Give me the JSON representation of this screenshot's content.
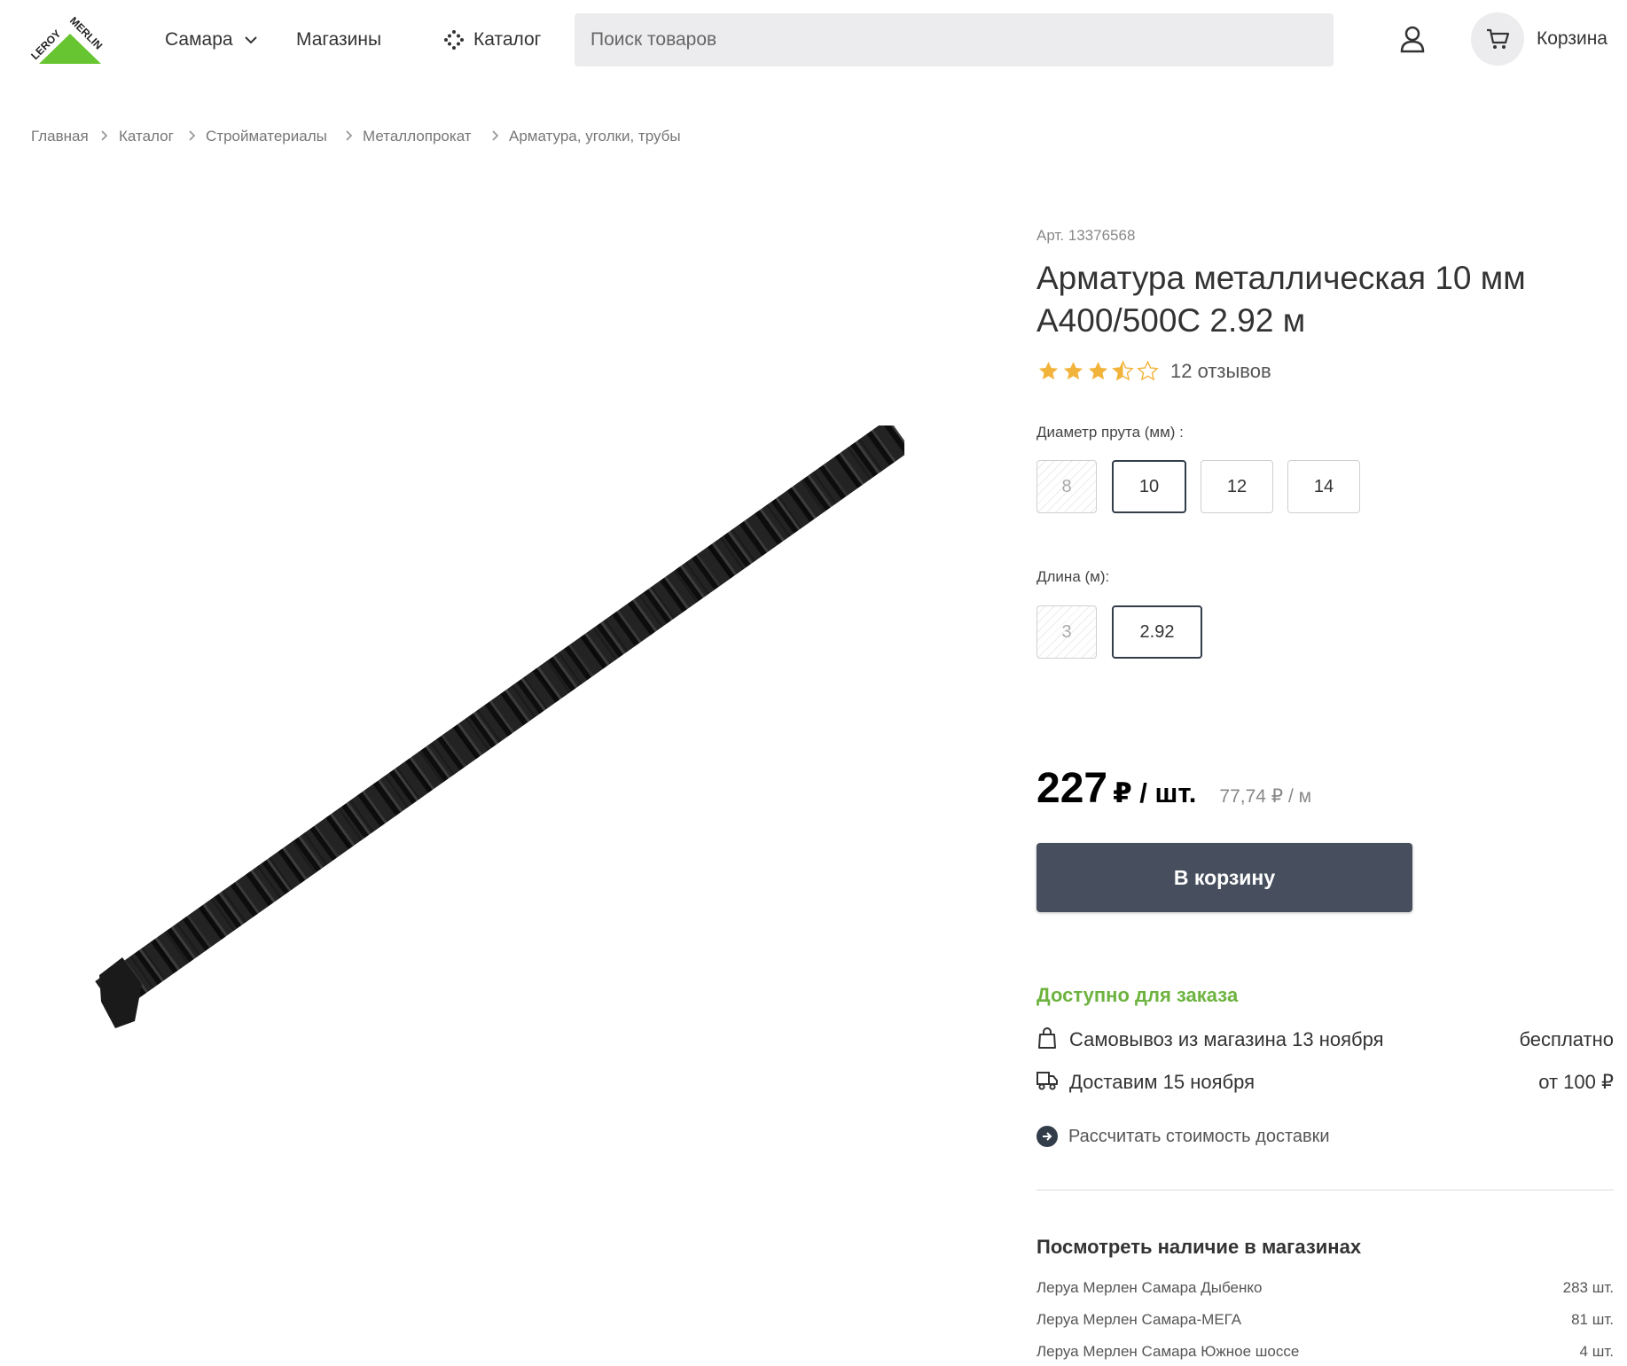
{
  "header": {
    "city": "Самара",
    "stores_link": "Магазины",
    "catalog_link": "Каталог",
    "search_placeholder": "Поиск товаров",
    "cart_label": "Корзина",
    "logo_text": "LEROY MERLIN"
  },
  "breadcrumbs": [
    "Главная",
    "Каталог",
    "Стройматериалы",
    "Металлопрокат",
    "Арматура, уголки, трубы"
  ],
  "product": {
    "article": "Арт. 13376568",
    "title_line1": "Арматура металлическая 10 мм",
    "title_line2": "А400/500С 2.92 м",
    "rating": 3.5,
    "rating_max": 5,
    "reviews": "12 отзывов",
    "image_icon": "rebar-image"
  },
  "options": {
    "diameter": {
      "label": "Диаметр прута (мм) :",
      "values": [
        "8",
        "10",
        "12",
        "14"
      ],
      "selected": "10",
      "unavailable": [
        "8"
      ]
    },
    "length": {
      "label": "Длина (м):",
      "values": [
        "3",
        "2.92"
      ],
      "selected": "2.92",
      "unavailable": [
        "3"
      ]
    }
  },
  "price": {
    "value": "227",
    "currency_unit": "₽ / шт.",
    "per_meter": "77,74 ₽ / м"
  },
  "actions": {
    "add_to_cart": "В корзину"
  },
  "availability": {
    "status": "Доступно для заказа",
    "pickup_label": "Самовывоз из магазина 13 ноября",
    "pickup_price": "бесплатно",
    "delivery_label": "Доставим 15 ноября",
    "delivery_price": "от 100 ₽",
    "calc_link": "Рассчитать стоимость доставки"
  },
  "stores": {
    "title": "Посмотреть наличие в магазинах",
    "items": [
      {
        "name": "Леруа Мерлен Самара Дыбенко",
        "qty": "283 шт."
      },
      {
        "name": "Леруа Мерлен Самара-МЕГА",
        "qty": "81 шт."
      },
      {
        "name": "Леруа Мерлен Самара Южное шоссе",
        "qty": "4 шт."
      }
    ]
  },
  "colors": {
    "brand_green": "#66c530",
    "available_green": "#6db33f",
    "button_dark": "#474f5e",
    "star": "#f2b33b"
  }
}
